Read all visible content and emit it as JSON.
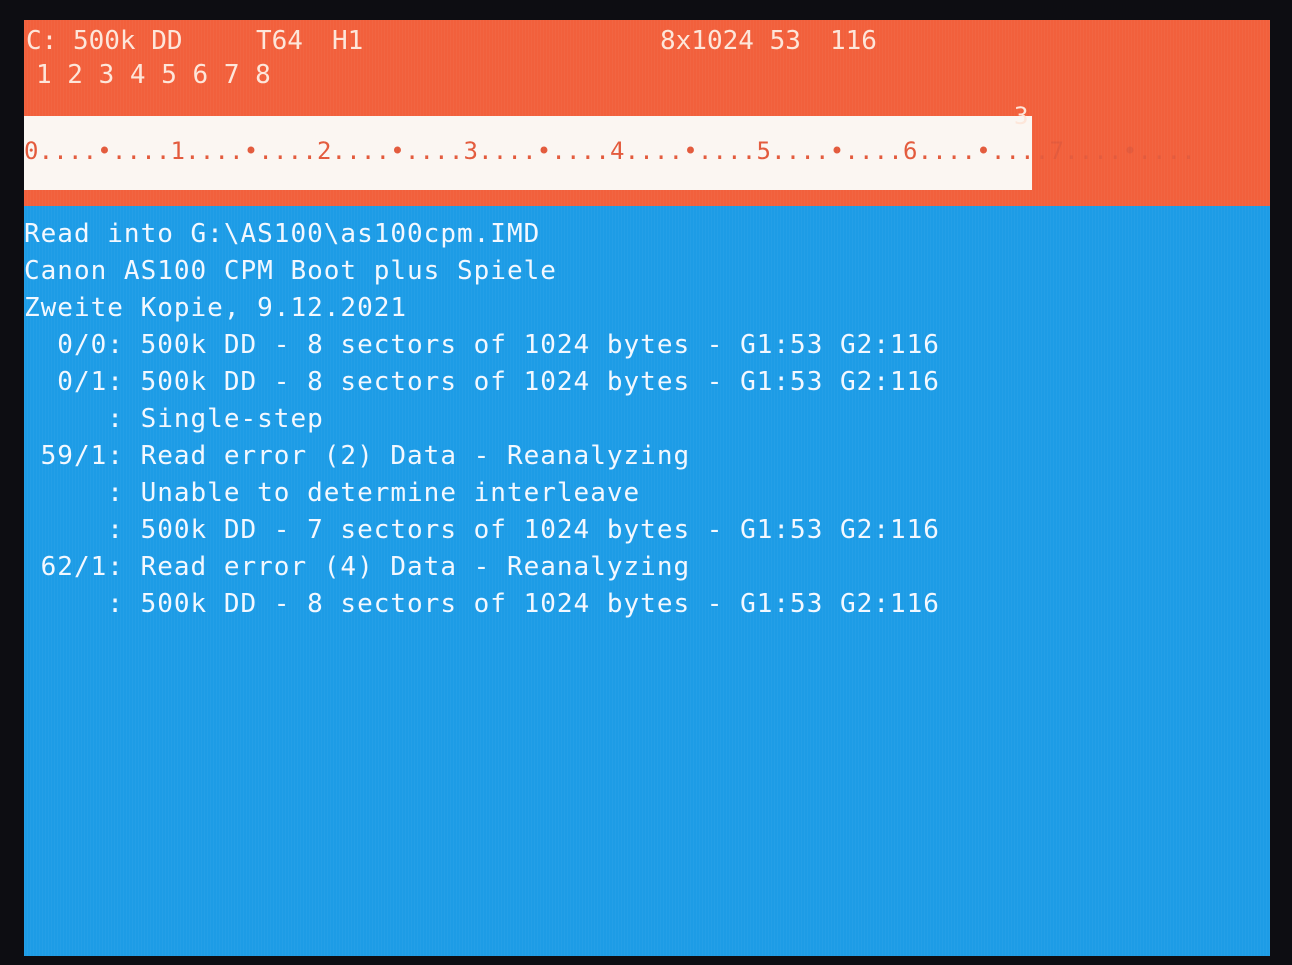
{
  "colors": {
    "status_background": "#f2603c",
    "ruler_background": "#fbf6f2",
    "ruler_text": "#e35a3c",
    "log_background": "#1d9ce6",
    "log_text": "#f3f8ff"
  },
  "status": {
    "drive_format": "C: 500k DD",
    "track": "T64",
    "head": "H1",
    "geometry": "8x1024 53",
    "gap": "116",
    "sector_map": "1 2 3 4 5 6 7 8"
  },
  "ruler": {
    "scale": "0....•....1....•....2....•....3....•....4....•....5....•....6....•....7....•....",
    "cursor_label": "3"
  },
  "log": [
    "Read into G:\\AS100\\as100cpm.IMD",
    "Canon AS100 CPM Boot plus Spiele",
    "Zweite Kopie, 9.12.2021",
    "  0/0: 500k DD - 8 sectors of 1024 bytes - G1:53 G2:116",
    "  0/1: 500k DD - 8 sectors of 1024 bytes - G1:53 G2:116",
    "     : Single-step",
    " 59/1: Read error (2) Data - Reanalyzing",
    "     : Unable to determine interleave",
    "     : 500k DD - 7 sectors of 1024 bytes - G1:53 G2:116",
    " 62/1: Read error (4) Data - Reanalyzing",
    "     : 500k DD - 8 sectors of 1024 bytes - G1:53 G2:116"
  ]
}
